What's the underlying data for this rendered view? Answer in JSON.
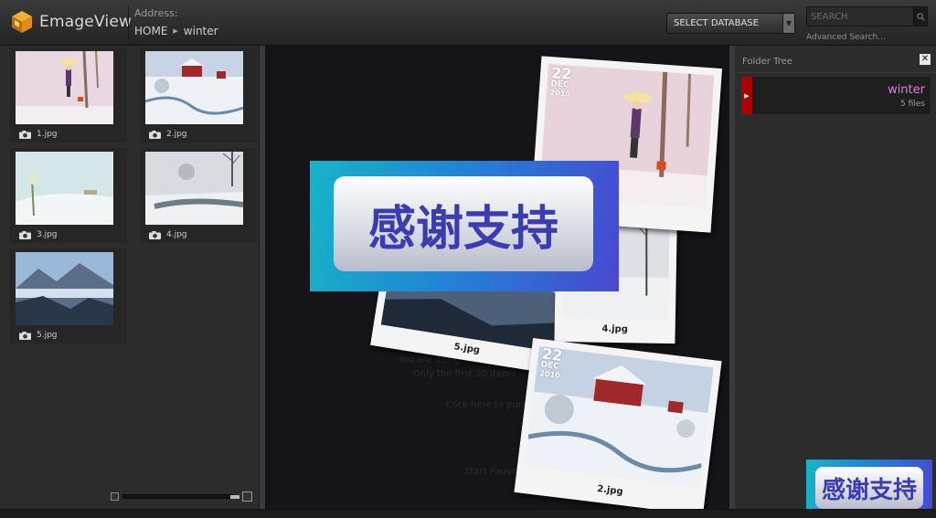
{
  "app": {
    "name": "EmageView"
  },
  "header": {
    "address_label": "Address:",
    "breadcrumb": [
      "HOME",
      "winter"
    ],
    "database_select": "SELECT DATABASE",
    "search_placeholder": "SEARCH",
    "advanced_search": "Advanced Search..."
  },
  "thumbnails": [
    {
      "name": "1.jpg"
    },
    {
      "name": "2.jpg"
    },
    {
      "name": "3.jpg"
    },
    {
      "name": "4.jpg"
    },
    {
      "name": "5.jpg"
    }
  ],
  "viewer": {
    "photos": [
      {
        "label": "5.jpg"
      },
      {
        "label": "4.jpg"
      },
      {
        "label": "2.jpg",
        "stamp": [
          "22",
          "DEC",
          "2010"
        ]
      },
      {
        "label": "",
        "stamp": [
          "22",
          "DEC",
          "2010"
        ]
      }
    ],
    "faint_texts": [
      "You are using",
      "Only the first 20 items",
      "Click here to purc",
      "Start Pause"
    ],
    "banner_text": "感谢支持"
  },
  "folder_tree": {
    "title": "Folder Tree",
    "items": [
      {
        "name": "winter",
        "count": "5 files"
      }
    ]
  },
  "corner_banner_text": "感谢支持"
}
